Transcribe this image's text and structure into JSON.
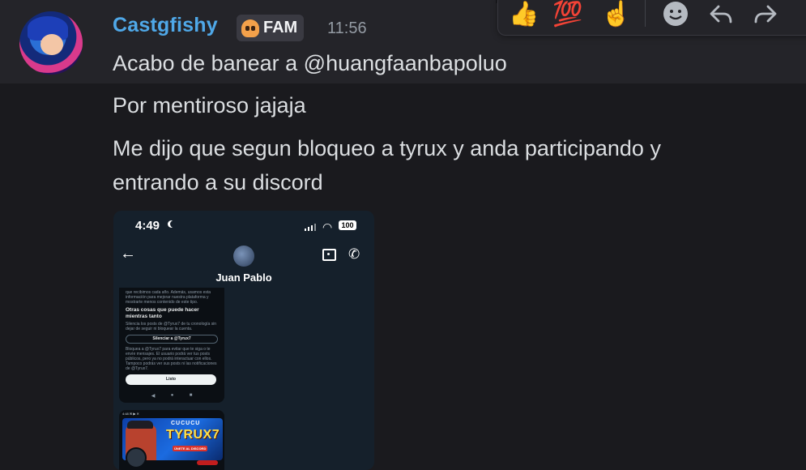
{
  "message": {
    "username": "Castgfishy",
    "role_tag": "FAM",
    "timestamp": "11:56",
    "lines": [
      "Acabo de banear a @huangfaanbapoluo",
      "Por mentiroso jajaja",
      "Me dijo que segun bloqueo a tyrux y anda participando y",
      "entrando a su discord"
    ]
  },
  "toolbar": {
    "reactions": [
      "👍",
      "💯",
      "☝️"
    ],
    "icons": [
      "add-reaction-icon",
      "reply-icon",
      "forward-icon"
    ]
  },
  "attachment": {
    "status_time": "4:49",
    "battery": "100",
    "contact_name": "Juan Pablo",
    "card1": {
      "intro": "que recibimos cada año. Además, usamos esta información para mejorar nuestra plataforma y mostrarte menos contenido de este tipo.",
      "heading": "Otras cosas que puede hacer mientras tanto",
      "mute_text": "Silencia los posts de @Tyrux7 de tu cronología sin dejar de seguir ni bloquear la cuenta.",
      "mute_button": "Silenciar a @Tyrux7",
      "block_text": "Bloquea a @Tyrux7 para evitar que te siga o te envíe mensajes. El usuario podrá ver tus posts públicos, pero ya no podrá interactuar con ellos. Tampoco podrás ver sus posts ni las notificaciones de @Tyrux7.",
      "done_button": "Listo",
      "nav": [
        "◀",
        "●",
        "■"
      ]
    },
    "card2": {
      "status": "4:48 ✉ ▶ ✕",
      "banner_top": "CUCUCU",
      "banner_title": "TYRUX7",
      "banner_sub": "ÚNETE AL DISCORD"
    }
  }
}
